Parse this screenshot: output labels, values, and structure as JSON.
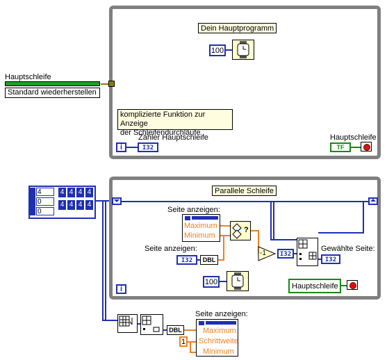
{
  "colors": {
    "int_blue": "#1f2fb4",
    "string_pink": "#d060c0",
    "bool_green": "#158a15",
    "dbl_orange": "#f08020",
    "note_bg": "#fffde0",
    "node_bg": "#ffffcc",
    "loop_gray": "#808080"
  },
  "top": {
    "main_program_label": "Dein Hauptprogramm",
    "wait_constant": "100",
    "complex_note": "komplizierte Funktion zur Anzeige\nder Schleifendurchläufe",
    "counter_label": "Zähler Hauptschleife",
    "iteration_terminal": "i",
    "counter_type": "I32",
    "stop_label": "Hauptschleife",
    "stop_bool": "TF"
  },
  "left": {
    "ref_label": "Hauptschleife",
    "button_label": "Standard wiederherstellen"
  },
  "array": {
    "index_values": [
      "4",
      "0",
      "0"
    ],
    "cells": [
      "4",
      "4",
      "4",
      "4",
      "4",
      "4",
      "4",
      "4"
    ]
  },
  "bottom": {
    "parallel_label": "Parallele Schleife",
    "page_display_label_1": "Seite anzeigen:",
    "max_label": "Maximum",
    "min_label": "Minimum",
    "page_display_label_2": "Seite anzeigen:",
    "i32_text": "I32",
    "dbl_text": "DBL",
    "minus_one": "-1",
    "selected_page_label": "Gewählte Seite:",
    "wait_constant": "100",
    "main_loop_ref": "Hauptschleife",
    "iteration_terminal": "i"
  },
  "lower": {
    "page_display_label": "Seite anzeigen:",
    "dbl_text": "DBL",
    "max_label": "Maximum",
    "step_label": "Schrittweite",
    "min_label": "Minimum",
    "step_constant": "1"
  }
}
